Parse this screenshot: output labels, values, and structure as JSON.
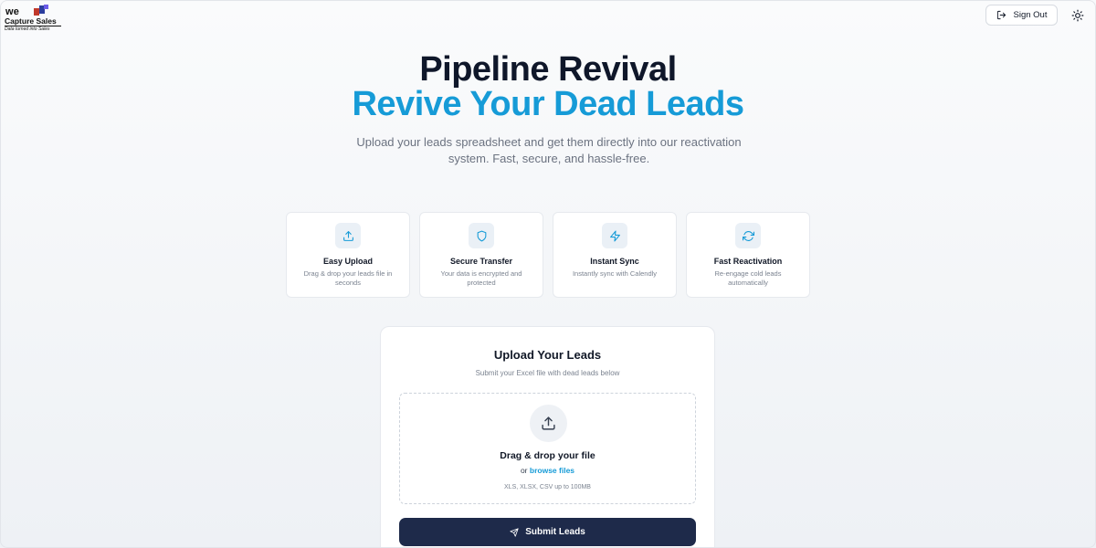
{
  "logo": {
    "top_text": "we",
    "brand": "Capture Sales",
    "tagline": "Data turned into Sales"
  },
  "header": {
    "signout_label": "Sign Out",
    "signout_icon": "logout-icon",
    "theme_icon": "sun-icon"
  },
  "hero": {
    "title": "Pipeline Revival",
    "subtitle": "Revive Your Dead Leads",
    "description": "Upload your leads spreadsheet and get them directly into our reactivation system. Fast, secure, and hassle-free."
  },
  "features": [
    {
      "icon": "upload-icon",
      "title": "Easy Upload",
      "desc": "Drag & drop your leads file in seconds"
    },
    {
      "icon": "shield-icon",
      "title": "Secure Transfer",
      "desc": "Your data is encrypted and protected"
    },
    {
      "icon": "zap-icon",
      "title": "Instant Sync",
      "desc": "Instantly sync with Calendly"
    },
    {
      "icon": "refresh-icon",
      "title": "Fast Reactivation",
      "desc": "Re-engage cold leads automatically"
    }
  ],
  "upload": {
    "title": "Upload Your Leads",
    "subtitle": "Submit your Excel file with dead leads below",
    "drop_title": "Drag & drop your file",
    "or_text": "or",
    "browse_label": "browse files",
    "hint": "XLS, XLSX, CSV up to 100MB",
    "submit_label": "Submit Leads"
  },
  "colors": {
    "accent": "#169bd7",
    "primary_button": "#1e2a4a",
    "title": "#0f172a"
  }
}
